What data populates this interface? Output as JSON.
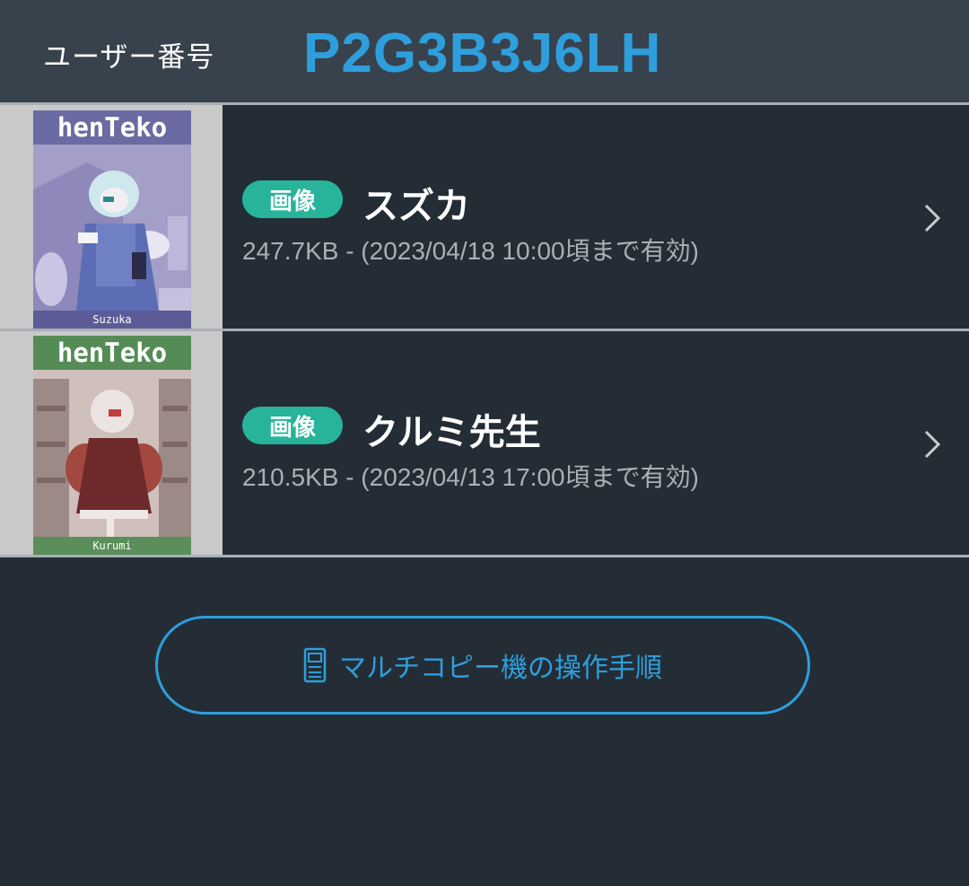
{
  "header": {
    "user_label": "ユーザー番号",
    "user_code": "P2G3B3J6LH"
  },
  "files": [
    {
      "badge": "画像",
      "title": "スズカ",
      "meta": "247.7KB - (2023/04/18 10:00頃まで有効)",
      "thumbnail": {
        "brand": "henTeko",
        "caption": "Suzuka"
      }
    },
    {
      "badge": "画像",
      "title": "クルミ先生",
      "meta": "210.5KB - (2023/04/13 17:00頃まで有効)",
      "thumbnail": {
        "brand": "henTeko",
        "caption": "Kurumi"
      }
    }
  ],
  "actions": {
    "copier_instructions": "マルチコピー機の操作手順"
  },
  "icons": {
    "row_arrow": "chevron-right-icon",
    "button_icon": "copier-icon"
  },
  "colors": {
    "background": "#242d36",
    "header": "#37424c",
    "accent": "#2e9fdc",
    "badge": "#27b49a"
  }
}
